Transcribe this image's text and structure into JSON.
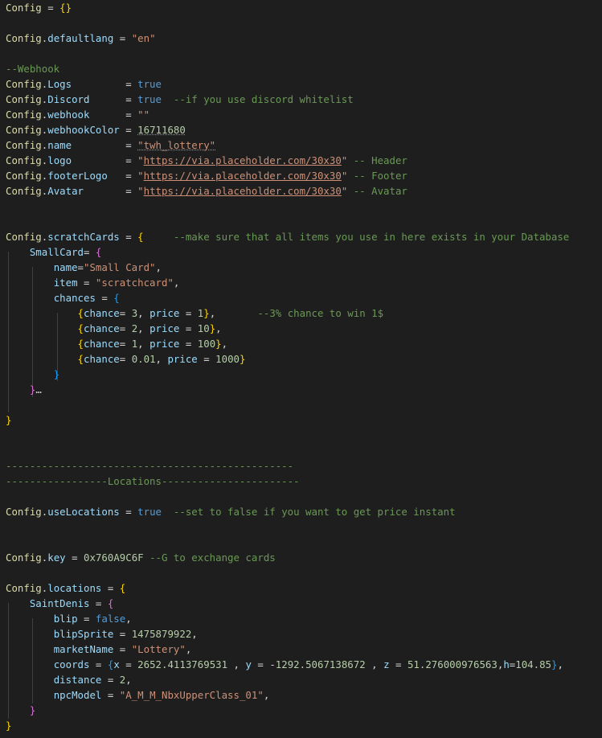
{
  "colors": {
    "background": "#1e1e1e",
    "keyword": "#569cd6",
    "string": "#ce9178",
    "number": "#b5cea8",
    "comment": "#6a9955",
    "variable": "#9cdcfe",
    "table_name": "#dcdcaa",
    "brace_gold": "#ffd700",
    "brace_purple": "#da70d6",
    "brace_blue": "#179fff",
    "operator": "#d4d4d4"
  },
  "code_lines": [
    {
      "row": 0,
      "tokens": [
        {
          "t": "Config",
          "c": "table_name"
        },
        {
          "t": " = ",
          "c": "operator"
        },
        {
          "t": "{}",
          "c": "brace_gold"
        }
      ]
    },
    {
      "row": 2,
      "tokens": [
        {
          "t": "Config",
          "c": "table_name"
        },
        {
          "t": ".",
          "c": "operator"
        },
        {
          "t": "defaultlang",
          "c": "variable"
        },
        {
          "t": " = ",
          "c": "operator"
        },
        {
          "t": "\"en\"",
          "c": "string"
        }
      ]
    },
    {
      "row": 4,
      "tokens": [
        {
          "t": "--Webhook",
          "c": "comment"
        }
      ]
    },
    {
      "row": 5,
      "tokens": [
        {
          "t": "Config",
          "c": "table_name"
        },
        {
          "t": ".",
          "c": "operator"
        },
        {
          "t": "Logs",
          "c": "variable"
        },
        {
          "t": "         = ",
          "c": "operator"
        },
        {
          "t": "true",
          "c": "keyword"
        }
      ]
    },
    {
      "row": 6,
      "tokens": [
        {
          "t": "Config",
          "c": "table_name"
        },
        {
          "t": ".",
          "c": "operator"
        },
        {
          "t": "Discord",
          "c": "variable"
        },
        {
          "t": "      = ",
          "c": "operator"
        },
        {
          "t": "true",
          "c": "keyword"
        },
        {
          "t": "  --if you use discord whitelist",
          "c": "comment"
        }
      ]
    },
    {
      "row": 7,
      "tokens": [
        {
          "t": "Config",
          "c": "table_name"
        },
        {
          "t": ".",
          "c": "operator"
        },
        {
          "t": "webhook",
          "c": "variable"
        },
        {
          "t": "      = ",
          "c": "operator"
        },
        {
          "t": "\"\"",
          "c": "string"
        }
      ]
    },
    {
      "row": 8,
      "tokens": [
        {
          "t": "Config",
          "c": "table_name"
        },
        {
          "t": ".",
          "c": "operator"
        },
        {
          "t": "webhookColor",
          "c": "variable"
        },
        {
          "t": " = ",
          "c": "operator"
        },
        {
          "t": "16711680",
          "c": "number",
          "squig": true
        }
      ]
    },
    {
      "row": 9,
      "tokens": [
        {
          "t": "Config",
          "c": "table_name"
        },
        {
          "t": ".",
          "c": "operator"
        },
        {
          "t": "name",
          "c": "variable"
        },
        {
          "t": "         = ",
          "c": "operator"
        },
        {
          "t": "\"twh_lottery\"",
          "c": "string",
          "squig": true
        }
      ]
    },
    {
      "row": 10,
      "tokens": [
        {
          "t": "Config",
          "c": "table_name"
        },
        {
          "t": ".",
          "c": "operator"
        },
        {
          "t": "logo",
          "c": "variable"
        },
        {
          "t": "         = ",
          "c": "operator"
        },
        {
          "t": "\"",
          "c": "string"
        },
        {
          "t": "https://via.placeholder.com/30x30",
          "c": "string",
          "url": true
        },
        {
          "t": "\"",
          "c": "string"
        },
        {
          "t": " -- Header",
          "c": "comment"
        }
      ]
    },
    {
      "row": 11,
      "tokens": [
        {
          "t": "Config",
          "c": "table_name"
        },
        {
          "t": ".",
          "c": "operator"
        },
        {
          "t": "footerLogo",
          "c": "variable"
        },
        {
          "t": "   = ",
          "c": "operator"
        },
        {
          "t": "\"",
          "c": "string"
        },
        {
          "t": "https://via.placeholder.com/30x30",
          "c": "string",
          "url": true
        },
        {
          "t": "\"",
          "c": "string"
        },
        {
          "t": " -- Footer",
          "c": "comment"
        }
      ]
    },
    {
      "row": 12,
      "tokens": [
        {
          "t": "Config",
          "c": "table_name"
        },
        {
          "t": ".",
          "c": "operator"
        },
        {
          "t": "Avatar",
          "c": "variable"
        },
        {
          "t": "       = ",
          "c": "operator"
        },
        {
          "t": "\"",
          "c": "string"
        },
        {
          "t": "https://via.placeholder.com/30x30",
          "c": "string",
          "url": true
        },
        {
          "t": "\"",
          "c": "string"
        },
        {
          "t": " -- Avatar",
          "c": "comment"
        }
      ]
    },
    {
      "row": 15,
      "tokens": [
        {
          "t": "Config",
          "c": "table_name"
        },
        {
          "t": ".",
          "c": "operator"
        },
        {
          "t": "scratchCards",
          "c": "variable"
        },
        {
          "t": " = ",
          "c": "operator"
        },
        {
          "t": "{",
          "c": "brace_gold"
        },
        {
          "t": "     --make sure that all items you use in here exists in your Database",
          "c": "comment"
        }
      ]
    },
    {
      "row": 16,
      "tokens": [
        {
          "t": "    ",
          "c": "operator"
        },
        {
          "t": "SmallCard",
          "c": "variable"
        },
        {
          "t": "= ",
          "c": "operator"
        },
        {
          "t": "{",
          "c": "brace_purple"
        }
      ]
    },
    {
      "row": 17,
      "tokens": [
        {
          "t": "        ",
          "c": "operator"
        },
        {
          "t": "name",
          "c": "variable"
        },
        {
          "t": "=",
          "c": "operator"
        },
        {
          "t": "\"Small Card\"",
          "c": "string"
        },
        {
          "t": ",",
          "c": "operator"
        }
      ]
    },
    {
      "row": 18,
      "tokens": [
        {
          "t": "        ",
          "c": "operator"
        },
        {
          "t": "item",
          "c": "variable"
        },
        {
          "t": " = ",
          "c": "operator"
        },
        {
          "t": "\"scratchcard\"",
          "c": "string"
        },
        {
          "t": ",",
          "c": "operator"
        }
      ]
    },
    {
      "row": 19,
      "tokens": [
        {
          "t": "        ",
          "c": "operator"
        },
        {
          "t": "chances",
          "c": "variable"
        },
        {
          "t": " = ",
          "c": "operator"
        },
        {
          "t": "{",
          "c": "brace_blue"
        }
      ]
    },
    {
      "row": 20,
      "tokens": [
        {
          "t": "            ",
          "c": "operator"
        },
        {
          "t": "{",
          "c": "brace_gold"
        },
        {
          "t": "chance",
          "c": "variable"
        },
        {
          "t": "= ",
          "c": "operator"
        },
        {
          "t": "3",
          "c": "number"
        },
        {
          "t": ", ",
          "c": "operator"
        },
        {
          "t": "price",
          "c": "variable"
        },
        {
          "t": " = ",
          "c": "operator"
        },
        {
          "t": "1",
          "c": "number"
        },
        {
          "t": "}",
          "c": "brace_gold"
        },
        {
          "t": ",",
          "c": "operator"
        },
        {
          "t": "       --3% chance to win 1$",
          "c": "comment"
        }
      ]
    },
    {
      "row": 21,
      "tokens": [
        {
          "t": "            ",
          "c": "operator"
        },
        {
          "t": "{",
          "c": "brace_gold"
        },
        {
          "t": "chance",
          "c": "variable"
        },
        {
          "t": "= ",
          "c": "operator"
        },
        {
          "t": "2",
          "c": "number"
        },
        {
          "t": ", ",
          "c": "operator"
        },
        {
          "t": "price",
          "c": "variable"
        },
        {
          "t": " = ",
          "c": "operator"
        },
        {
          "t": "10",
          "c": "number"
        },
        {
          "t": "}",
          "c": "brace_gold"
        },
        {
          "t": ",",
          "c": "operator"
        }
      ]
    },
    {
      "row": 22,
      "tokens": [
        {
          "t": "            ",
          "c": "operator"
        },
        {
          "t": "{",
          "c": "brace_gold"
        },
        {
          "t": "chance",
          "c": "variable"
        },
        {
          "t": "= ",
          "c": "operator"
        },
        {
          "t": "1",
          "c": "number"
        },
        {
          "t": ", ",
          "c": "operator"
        },
        {
          "t": "price",
          "c": "variable"
        },
        {
          "t": " = ",
          "c": "operator"
        },
        {
          "t": "100",
          "c": "number"
        },
        {
          "t": "}",
          "c": "brace_gold"
        },
        {
          "t": ",",
          "c": "operator"
        }
      ]
    },
    {
      "row": 23,
      "tokens": [
        {
          "t": "            ",
          "c": "operator"
        },
        {
          "t": "{",
          "c": "brace_gold"
        },
        {
          "t": "chance",
          "c": "variable"
        },
        {
          "t": "= ",
          "c": "operator"
        },
        {
          "t": "0.01",
          "c": "number"
        },
        {
          "t": ", ",
          "c": "operator"
        },
        {
          "t": "price",
          "c": "variable"
        },
        {
          "t": " = ",
          "c": "operator"
        },
        {
          "t": "1000",
          "c": "number"
        },
        {
          "t": "}",
          "c": "brace_gold"
        }
      ]
    },
    {
      "row": 24,
      "tokens": [
        {
          "t": "        ",
          "c": "operator"
        },
        {
          "t": "}",
          "c": "brace_blue"
        }
      ]
    },
    {
      "row": 25,
      "tokens": [
        {
          "t": "    ",
          "c": "operator"
        },
        {
          "t": "}",
          "c": "brace_purple"
        },
        {
          "t": "…",
          "c": "operator"
        }
      ]
    },
    {
      "row": 27,
      "tokens": [
        {
          "t": "}",
          "c": "brace_gold"
        }
      ]
    },
    {
      "row": 30,
      "tokens": [
        {
          "t": "------------------------------------------------",
          "c": "comment"
        }
      ]
    },
    {
      "row": 31,
      "tokens": [
        {
          "t": "-----------------Locations-----------------------",
          "c": "comment"
        }
      ]
    },
    {
      "row": 33,
      "tokens": [
        {
          "t": "Config",
          "c": "table_name"
        },
        {
          "t": ".",
          "c": "operator"
        },
        {
          "t": "useLocations",
          "c": "variable"
        },
        {
          "t": " = ",
          "c": "operator"
        },
        {
          "t": "true",
          "c": "keyword"
        },
        {
          "t": "  --set to false if you want to get price instant",
          "c": "comment"
        }
      ]
    },
    {
      "row": 36,
      "tokens": [
        {
          "t": "Config",
          "c": "table_name"
        },
        {
          "t": ".",
          "c": "operator"
        },
        {
          "t": "key",
          "c": "variable"
        },
        {
          "t": " = ",
          "c": "operator"
        },
        {
          "t": "0x760A9C6F",
          "c": "number"
        },
        {
          "t": " --G to exchange cards",
          "c": "comment"
        }
      ]
    },
    {
      "row": 38,
      "tokens": [
        {
          "t": "Config",
          "c": "table_name"
        },
        {
          "t": ".",
          "c": "operator"
        },
        {
          "t": "locations",
          "c": "variable"
        },
        {
          "t": " = ",
          "c": "operator"
        },
        {
          "t": "{",
          "c": "brace_gold"
        }
      ]
    },
    {
      "row": 39,
      "tokens": [
        {
          "t": "    ",
          "c": "operator"
        },
        {
          "t": "SaintDenis",
          "c": "variable"
        },
        {
          "t": " = ",
          "c": "operator"
        },
        {
          "t": "{",
          "c": "brace_purple"
        }
      ]
    },
    {
      "row": 40,
      "tokens": [
        {
          "t": "        ",
          "c": "operator"
        },
        {
          "t": "blip",
          "c": "variable"
        },
        {
          "t": " = ",
          "c": "operator"
        },
        {
          "t": "false",
          "c": "keyword"
        },
        {
          "t": ",",
          "c": "operator"
        }
      ]
    },
    {
      "row": 41,
      "tokens": [
        {
          "t": "        ",
          "c": "operator"
        },
        {
          "t": "blipSprite",
          "c": "variable"
        },
        {
          "t": " = ",
          "c": "operator"
        },
        {
          "t": "1475879922",
          "c": "number"
        },
        {
          "t": ",",
          "c": "operator"
        }
      ]
    },
    {
      "row": 42,
      "tokens": [
        {
          "t": "        ",
          "c": "operator"
        },
        {
          "t": "marketName",
          "c": "variable"
        },
        {
          "t": " = ",
          "c": "operator"
        },
        {
          "t": "\"Lottery\"",
          "c": "string"
        },
        {
          "t": ",",
          "c": "operator"
        }
      ]
    },
    {
      "row": 43,
      "tokens": [
        {
          "t": "        ",
          "c": "operator"
        },
        {
          "t": "coords",
          "c": "variable"
        },
        {
          "t": " = ",
          "c": "operator"
        },
        {
          "t": "{",
          "c": "brace_blue"
        },
        {
          "t": "x",
          "c": "variable"
        },
        {
          "t": " = ",
          "c": "operator"
        },
        {
          "t": "2652.4113769531",
          "c": "number"
        },
        {
          "t": " , ",
          "c": "operator"
        },
        {
          "t": "y",
          "c": "variable"
        },
        {
          "t": " = -",
          "c": "operator"
        },
        {
          "t": "1292.5067138672",
          "c": "number"
        },
        {
          "t": " , ",
          "c": "operator"
        },
        {
          "t": "z",
          "c": "variable"
        },
        {
          "t": " = ",
          "c": "operator"
        },
        {
          "t": "51.276000976563",
          "c": "number"
        },
        {
          "t": ",",
          "c": "operator"
        },
        {
          "t": "h",
          "c": "variable"
        },
        {
          "t": "=",
          "c": "operator"
        },
        {
          "t": "104.85",
          "c": "number"
        },
        {
          "t": "}",
          "c": "brace_blue"
        },
        {
          "t": ",",
          "c": "operator"
        }
      ]
    },
    {
      "row": 44,
      "tokens": [
        {
          "t": "        ",
          "c": "operator"
        },
        {
          "t": "distance",
          "c": "variable"
        },
        {
          "t": " = ",
          "c": "operator"
        },
        {
          "t": "2",
          "c": "number"
        },
        {
          "t": ",",
          "c": "operator"
        }
      ]
    },
    {
      "row": 45,
      "tokens": [
        {
          "t": "        ",
          "c": "operator"
        },
        {
          "t": "npcModel",
          "c": "variable"
        },
        {
          "t": " = ",
          "c": "operator"
        },
        {
          "t": "\"A_M_M_NbxUpperClass_01\"",
          "c": "string"
        },
        {
          "t": ",",
          "c": "operator"
        }
      ]
    },
    {
      "row": 46,
      "tokens": [
        {
          "t": "    ",
          "c": "operator"
        },
        {
          "t": "}",
          "c": "brace_purple"
        }
      ]
    },
    {
      "row": 47,
      "tokens": [
        {
          "t": "}",
          "c": "brace_gold"
        }
      ]
    }
  ]
}
